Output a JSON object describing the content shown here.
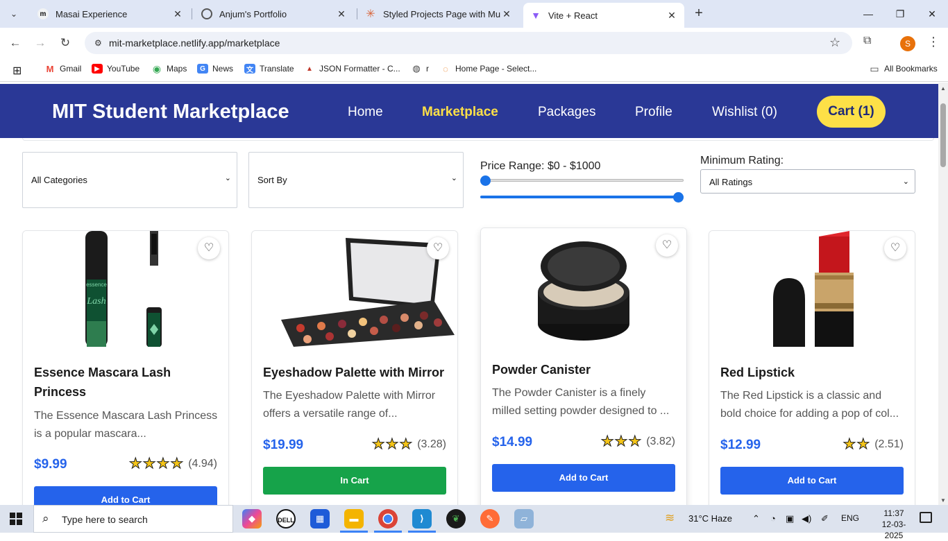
{
  "browser": {
    "tabs": [
      {
        "title": "Masai Experience",
        "favicon": "m"
      },
      {
        "title": "Anjum's Portfolio",
        "favicon": "globe"
      },
      {
        "title": "Styled Projects Page with Multi",
        "favicon": "spark"
      },
      {
        "title": "Vite + React",
        "favicon": "vite"
      }
    ],
    "url": "mit-marketplace.netlify.app/marketplace",
    "profile_initial": "S",
    "bookmarks": [
      "Gmail",
      "YouTube",
      "Maps",
      "News",
      "Translate",
      "JSON Formatter - C...",
      "r",
      "Home Page - Select..."
    ],
    "all_bookmarks": "All Bookmarks"
  },
  "navbar": {
    "brand": "MIT Student Marketplace",
    "links": [
      "Home",
      "Marketplace",
      "Packages",
      "Profile",
      "Wishlist (0)"
    ],
    "active": "Marketplace",
    "cart": "Cart (1)"
  },
  "filters": {
    "category": "All Categories",
    "sort": "Sort By",
    "price_range_label": "Price Range: $0 - $1000",
    "price_min": 0,
    "price_max": 1000,
    "rating_label": "Minimum Rating:",
    "rating_value": "All Ratings"
  },
  "products": [
    {
      "name": "Essence Mascara Lash Princess",
      "desc": "The Essence Mascara Lash Princess is a popular mascara...",
      "price": "$9.99",
      "stars": 4,
      "rating": "(4.94)",
      "button": "Add to Cart",
      "in_cart": false
    },
    {
      "name": "Eyeshadow Palette with Mirror",
      "desc": "The Eyeshadow Palette with Mirror offers a versatile range of...",
      "price": "$19.99",
      "stars": 3,
      "rating": "(3.28)",
      "button": "In Cart",
      "in_cart": true
    },
    {
      "name": "Powder Canister",
      "desc": "The Powder Canister is a finely milled setting powder designed to ...",
      "price": "$14.99",
      "stars": 3,
      "rating": "(3.82)",
      "button": "Add to Cart",
      "in_cart": false
    },
    {
      "name": "Red Lipstick",
      "desc": "The Red Lipstick is a classic and bold choice for adding a pop of col...",
      "price": "$12.99",
      "stars": 2,
      "rating": "(2.51)",
      "button": "Add to Cart",
      "in_cart": false
    }
  ],
  "taskbar": {
    "search_placeholder": "Type here to search",
    "weather": "31°C  Haze",
    "lang": "ENG",
    "time": "11:37",
    "date": "12-03-2025"
  },
  "colors": {
    "navbar": "#2a3896",
    "accent_yellow": "#fde047",
    "price_blue": "#2563eb",
    "in_cart_green": "#16a34a"
  }
}
